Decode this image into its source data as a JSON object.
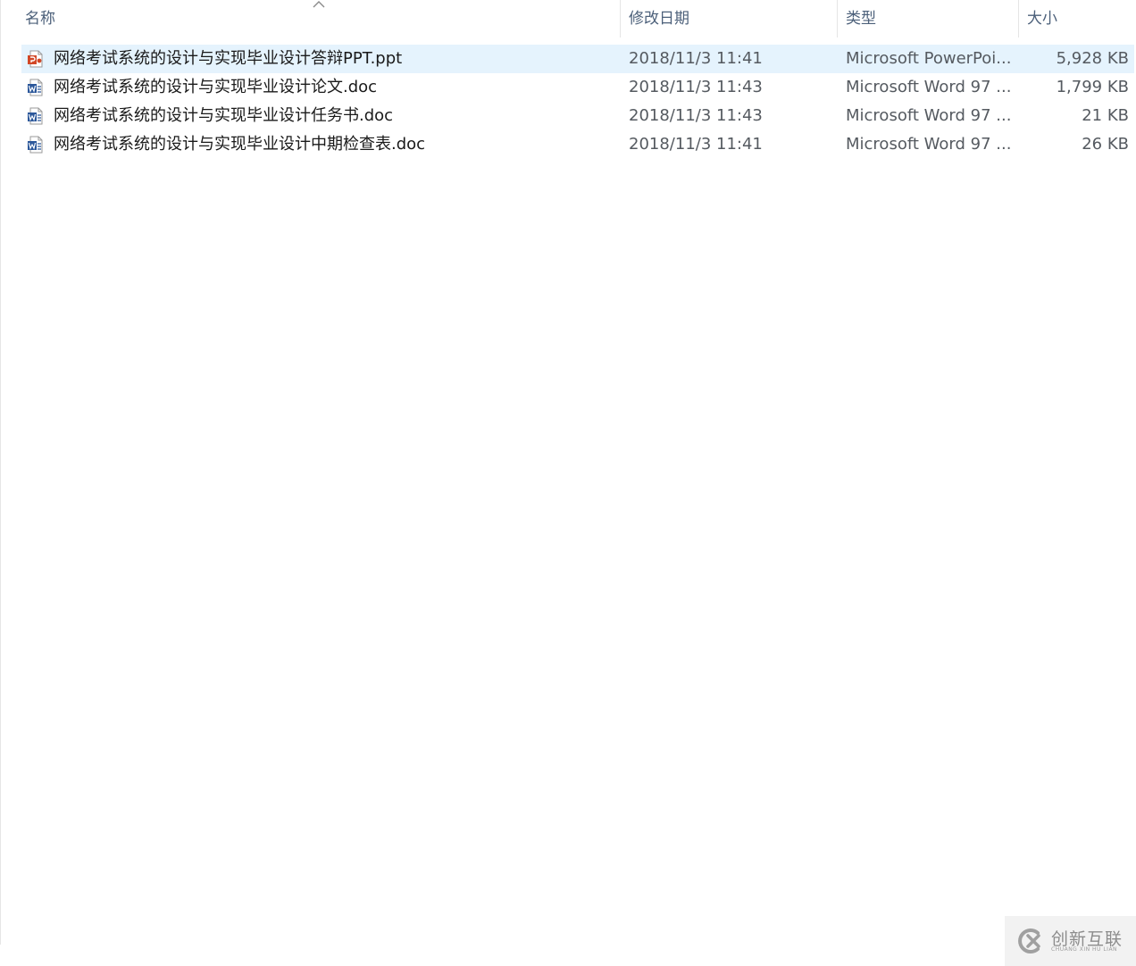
{
  "columns": {
    "name": "名称",
    "date": "修改日期",
    "type": "类型",
    "size": "大小"
  },
  "files": [
    {
      "name": "网络考试系统的设计与实现毕业设计答辩PPT.ppt",
      "date": "2018/11/3 11:41",
      "type": "Microsoft PowerPoi...",
      "size": "5,928 KB",
      "icon": "powerpoint-file-icon",
      "selected": true
    },
    {
      "name": "网络考试系统的设计与实现毕业设计论文.doc",
      "date": "2018/11/3 11:43",
      "type": "Microsoft Word 97 ...",
      "size": "1,799 KB",
      "icon": "word-file-icon",
      "selected": false
    },
    {
      "name": "网络考试系统的设计与实现毕业设计任务书.doc",
      "date": "2018/11/3 11:43",
      "type": "Microsoft Word 97 ...",
      "size": "21 KB",
      "icon": "word-file-icon",
      "selected": false
    },
    {
      "name": "网络考试系统的设计与实现毕业设计中期检查表.doc",
      "date": "2018/11/3 11:41",
      "type": "Microsoft Word 97 ...",
      "size": "26 KB",
      "icon": "word-file-icon",
      "selected": false
    }
  ],
  "watermark": {
    "title": "创新互联",
    "subtitle": "CHUANG XIN HU LIAN"
  },
  "colors": {
    "header_text": "#4c607a",
    "selected_row": "#e5f3fd",
    "ppt_accent": "#d24726",
    "word_accent": "#2b579a"
  }
}
